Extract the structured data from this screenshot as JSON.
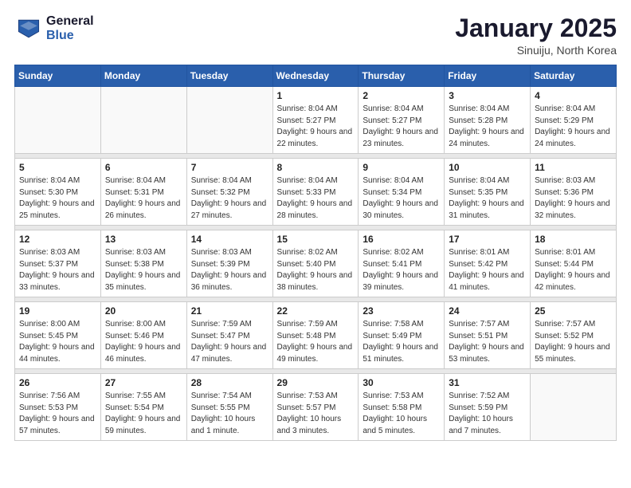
{
  "header": {
    "logo_general": "General",
    "logo_blue": "Blue",
    "month_title": "January 2025",
    "location": "Sinuiju, North Korea"
  },
  "weekdays": [
    "Sunday",
    "Monday",
    "Tuesday",
    "Wednesday",
    "Thursday",
    "Friday",
    "Saturday"
  ],
  "weeks": [
    [
      {
        "day": "",
        "info": ""
      },
      {
        "day": "",
        "info": ""
      },
      {
        "day": "",
        "info": ""
      },
      {
        "day": "1",
        "info": "Sunrise: 8:04 AM\nSunset: 5:27 PM\nDaylight: 9 hours\nand 22 minutes."
      },
      {
        "day": "2",
        "info": "Sunrise: 8:04 AM\nSunset: 5:27 PM\nDaylight: 9 hours\nand 23 minutes."
      },
      {
        "day": "3",
        "info": "Sunrise: 8:04 AM\nSunset: 5:28 PM\nDaylight: 9 hours\nand 24 minutes."
      },
      {
        "day": "4",
        "info": "Sunrise: 8:04 AM\nSunset: 5:29 PM\nDaylight: 9 hours\nand 24 minutes."
      }
    ],
    [
      {
        "day": "5",
        "info": "Sunrise: 8:04 AM\nSunset: 5:30 PM\nDaylight: 9 hours\nand 25 minutes."
      },
      {
        "day": "6",
        "info": "Sunrise: 8:04 AM\nSunset: 5:31 PM\nDaylight: 9 hours\nand 26 minutes."
      },
      {
        "day": "7",
        "info": "Sunrise: 8:04 AM\nSunset: 5:32 PM\nDaylight: 9 hours\nand 27 minutes."
      },
      {
        "day": "8",
        "info": "Sunrise: 8:04 AM\nSunset: 5:33 PM\nDaylight: 9 hours\nand 28 minutes."
      },
      {
        "day": "9",
        "info": "Sunrise: 8:04 AM\nSunset: 5:34 PM\nDaylight: 9 hours\nand 30 minutes."
      },
      {
        "day": "10",
        "info": "Sunrise: 8:04 AM\nSunset: 5:35 PM\nDaylight: 9 hours\nand 31 minutes."
      },
      {
        "day": "11",
        "info": "Sunrise: 8:03 AM\nSunset: 5:36 PM\nDaylight: 9 hours\nand 32 minutes."
      }
    ],
    [
      {
        "day": "12",
        "info": "Sunrise: 8:03 AM\nSunset: 5:37 PM\nDaylight: 9 hours\nand 33 minutes."
      },
      {
        "day": "13",
        "info": "Sunrise: 8:03 AM\nSunset: 5:38 PM\nDaylight: 9 hours\nand 35 minutes."
      },
      {
        "day": "14",
        "info": "Sunrise: 8:03 AM\nSunset: 5:39 PM\nDaylight: 9 hours\nand 36 minutes."
      },
      {
        "day": "15",
        "info": "Sunrise: 8:02 AM\nSunset: 5:40 PM\nDaylight: 9 hours\nand 38 minutes."
      },
      {
        "day": "16",
        "info": "Sunrise: 8:02 AM\nSunset: 5:41 PM\nDaylight: 9 hours\nand 39 minutes."
      },
      {
        "day": "17",
        "info": "Sunrise: 8:01 AM\nSunset: 5:42 PM\nDaylight: 9 hours\nand 41 minutes."
      },
      {
        "day": "18",
        "info": "Sunrise: 8:01 AM\nSunset: 5:44 PM\nDaylight: 9 hours\nand 42 minutes."
      }
    ],
    [
      {
        "day": "19",
        "info": "Sunrise: 8:00 AM\nSunset: 5:45 PM\nDaylight: 9 hours\nand 44 minutes."
      },
      {
        "day": "20",
        "info": "Sunrise: 8:00 AM\nSunset: 5:46 PM\nDaylight: 9 hours\nand 46 minutes."
      },
      {
        "day": "21",
        "info": "Sunrise: 7:59 AM\nSunset: 5:47 PM\nDaylight: 9 hours\nand 47 minutes."
      },
      {
        "day": "22",
        "info": "Sunrise: 7:59 AM\nSunset: 5:48 PM\nDaylight: 9 hours\nand 49 minutes."
      },
      {
        "day": "23",
        "info": "Sunrise: 7:58 AM\nSunset: 5:49 PM\nDaylight: 9 hours\nand 51 minutes."
      },
      {
        "day": "24",
        "info": "Sunrise: 7:57 AM\nSunset: 5:51 PM\nDaylight: 9 hours\nand 53 minutes."
      },
      {
        "day": "25",
        "info": "Sunrise: 7:57 AM\nSunset: 5:52 PM\nDaylight: 9 hours\nand 55 minutes."
      }
    ],
    [
      {
        "day": "26",
        "info": "Sunrise: 7:56 AM\nSunset: 5:53 PM\nDaylight: 9 hours\nand 57 minutes."
      },
      {
        "day": "27",
        "info": "Sunrise: 7:55 AM\nSunset: 5:54 PM\nDaylight: 9 hours\nand 59 minutes."
      },
      {
        "day": "28",
        "info": "Sunrise: 7:54 AM\nSunset: 5:55 PM\nDaylight: 10 hours\nand 1 minute."
      },
      {
        "day": "29",
        "info": "Sunrise: 7:53 AM\nSunset: 5:57 PM\nDaylight: 10 hours\nand 3 minutes."
      },
      {
        "day": "30",
        "info": "Sunrise: 7:53 AM\nSunset: 5:58 PM\nDaylight: 10 hours\nand 5 minutes."
      },
      {
        "day": "31",
        "info": "Sunrise: 7:52 AM\nSunset: 5:59 PM\nDaylight: 10 hours\nand 7 minutes."
      },
      {
        "day": "",
        "info": ""
      }
    ]
  ]
}
